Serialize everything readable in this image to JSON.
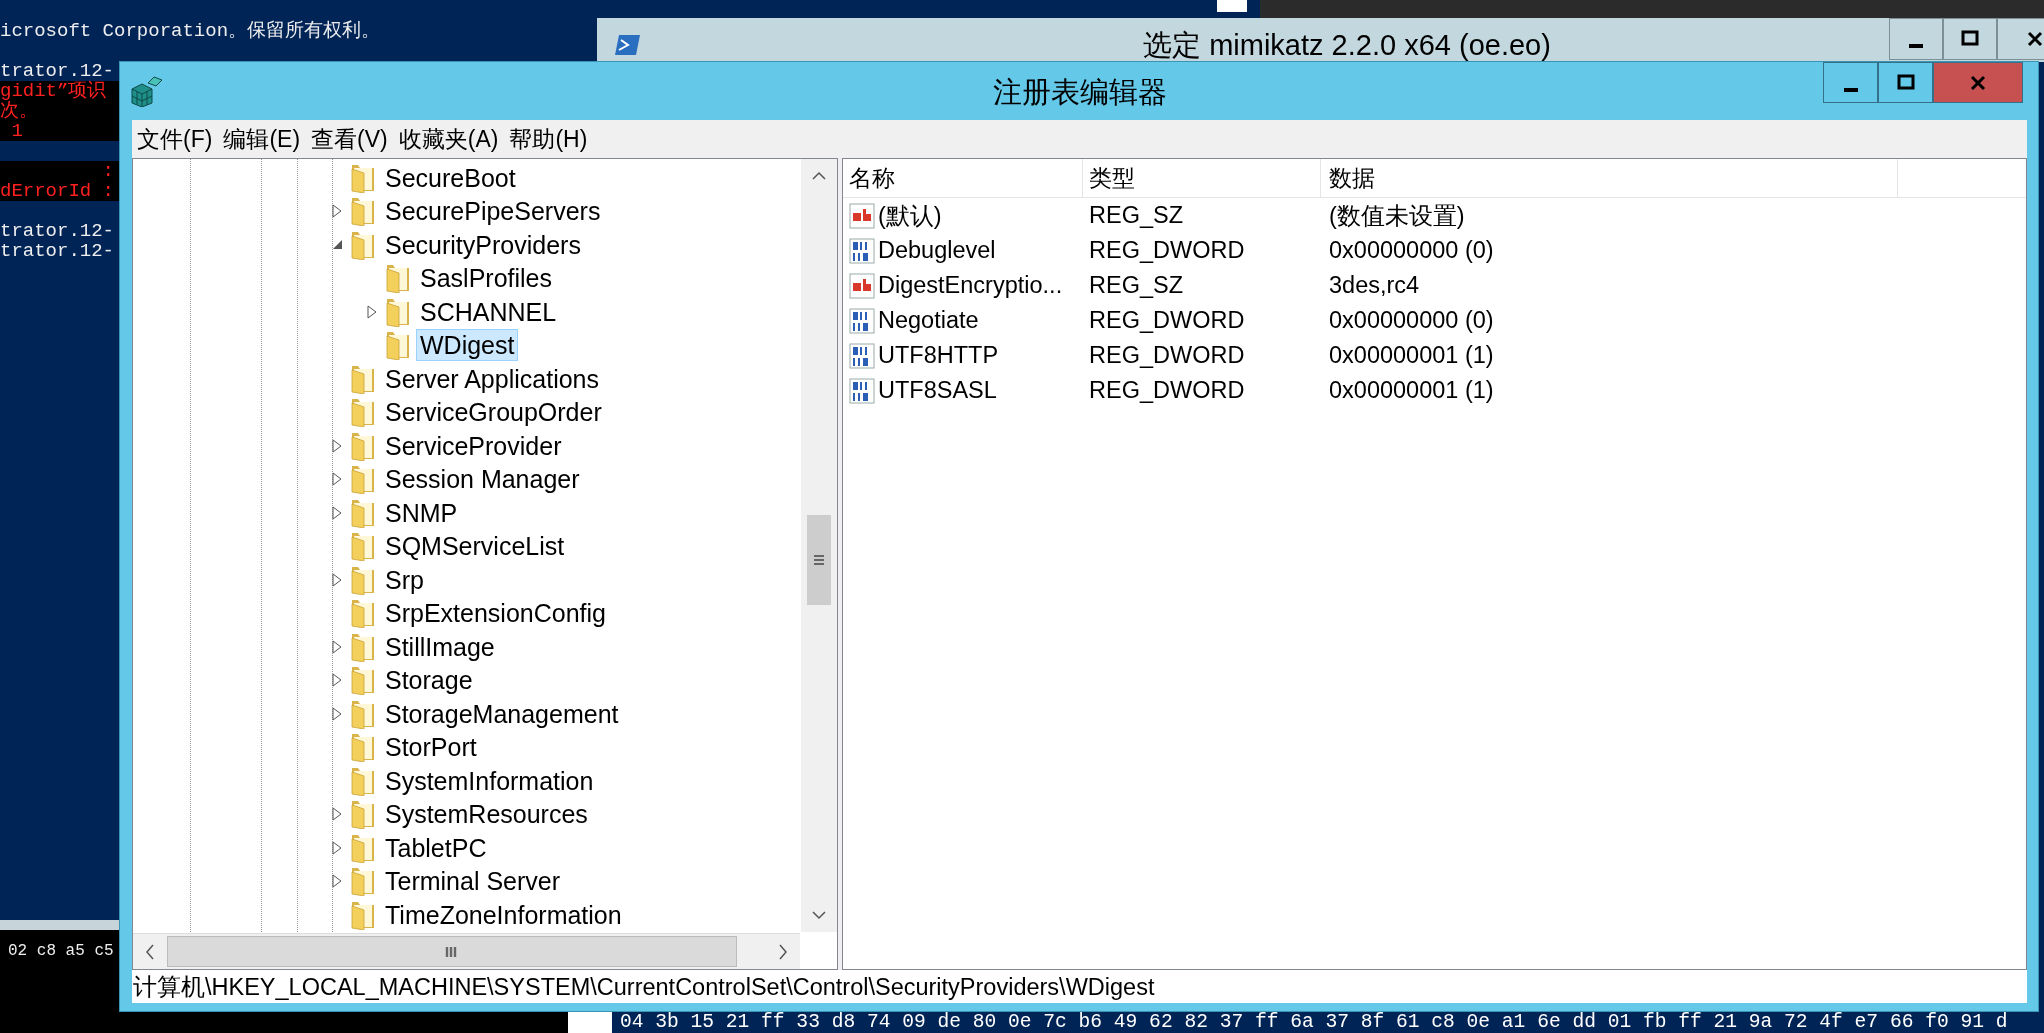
{
  "console": {
    "blocks": [
      [
        {
          "kind": "normal",
          "text": "icrosoft Corporation。保留所有权利。"
        }
      ],
      [
        {
          "kind": "normal",
          "text": "trator.12-"
        },
        {
          "kind": "error",
          "text": "gidit”项识"
        },
        {
          "kind": "error",
          "text": "次。"
        },
        {
          "kind": "error",
          "text": " 1"
        }
      ],
      [
        {
          "kind": "error",
          "text": "         :"
        },
        {
          "kind": "error",
          "text": "dErrorId :"
        }
      ],
      [
        {
          "kind": "normal",
          "text": "trator.12-"
        },
        {
          "kind": "normal",
          "text": "trator.12-"
        }
      ]
    ],
    "bottom_left": "02 c8 a5 c5",
    "bottom_strip": "04 3b 15 21 ff 33 d8 74 09 de 80 0e 7c b6 49 62 82 37 ff 6a 37 8f 61 c8 0e a1 6e dd 01 fb ff 21 9a 72 4f e7 66 f0 91 d"
  },
  "background_window": {
    "title": "选定 mimikatz 2.2.0 x64 (oe.eo)"
  },
  "window": {
    "title": "注册表编辑器"
  },
  "menu": [
    "文件(F)",
    "编辑(E)",
    "查看(V)",
    "收藏夹(A)",
    "帮助(H)"
  ],
  "tree": {
    "items": [
      {
        "label": "SecureBoot",
        "selected": false
      },
      {
        "label": "SecurePipeServers",
        "expanded": false,
        "selected": false
      },
      {
        "label": "SecurityProviders",
        "expanded": true,
        "selected": false,
        "children": [
          {
            "label": "SaslProfiles",
            "selected": false
          },
          {
            "label": "SCHANNEL",
            "expanded": false,
            "selected": false
          },
          {
            "label": "WDigest",
            "selected": true
          }
        ]
      },
      {
        "label": "Server Applications",
        "selected": false
      },
      {
        "label": "ServiceGroupOrder",
        "selected": false
      },
      {
        "label": "ServiceProvider",
        "expanded": false,
        "selected": false
      },
      {
        "label": "Session Manager",
        "expanded": false,
        "selected": false
      },
      {
        "label": "SNMP",
        "expanded": false,
        "selected": false
      },
      {
        "label": "SQMServiceList",
        "selected": false
      },
      {
        "label": "Srp",
        "expanded": false,
        "selected": false
      },
      {
        "label": "SrpExtensionConfig",
        "selected": false
      },
      {
        "label": "StillImage",
        "expanded": false,
        "selected": false
      },
      {
        "label": "Storage",
        "expanded": false,
        "selected": false
      },
      {
        "label": "StorageManagement",
        "expanded": false,
        "selected": false
      },
      {
        "label": "StorPort",
        "selected": false
      },
      {
        "label": "SystemInformation",
        "selected": false
      },
      {
        "label": "SystemResources",
        "expanded": false,
        "selected": false
      },
      {
        "label": "TabletPC",
        "expanded": false,
        "selected": false
      },
      {
        "label": "Terminal Server",
        "expanded": false,
        "selected": false
      },
      {
        "label": "TimeZoneInformation",
        "selected": false
      }
    ]
  },
  "list": {
    "columns": [
      "名称",
      "类型",
      "数据"
    ],
    "rows": [
      {
        "kind": "string",
        "name": "(默认)",
        "type": "REG_SZ",
        "data": "(数值未设置)"
      },
      {
        "kind": "dword",
        "name": "Debuglevel",
        "type": "REG_DWORD",
        "data": "0x00000000 (0)"
      },
      {
        "kind": "string",
        "name": "DigestEncryptio...",
        "type": "REG_SZ",
        "data": "3des,rc4"
      },
      {
        "kind": "dword",
        "name": "Negotiate",
        "type": "REG_DWORD",
        "data": "0x00000000 (0)"
      },
      {
        "kind": "dword",
        "name": "UTF8HTTP",
        "type": "REG_DWORD",
        "data": "0x00000001 (1)"
      },
      {
        "kind": "dword",
        "name": "UTF8SASL",
        "type": "REG_DWORD",
        "data": "0x00000001 (1)"
      }
    ]
  },
  "status_bar": "计算机\\HKEY_LOCAL_MACHINE\\SYSTEM\\CurrentControlSet\\Control\\SecurityProviders\\WDigest"
}
